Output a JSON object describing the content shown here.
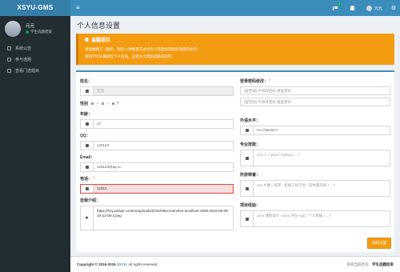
{
  "header": {
    "logo": "XSYU-GMS",
    "menu_icon": "≡",
    "notifications_badge": "4",
    "user_name": "元元",
    "settings_icon": "⚙"
  },
  "sidebar": {
    "user_name": "元元",
    "user_status": "学生选题结束",
    "items": [
      {
        "label": "系统公告",
        "icon": "bulletin-icon"
      },
      {
        "label": "参与选题",
        "icon": "pencil-icon"
      },
      {
        "label": "查看门选题目",
        "icon": "list-icon"
      }
    ]
  },
  "page": {
    "title": "个人信息设置"
  },
  "callout": {
    "title": "温馨提示",
    "line1": "请准确填写（编号，别的 3 种联系方式中至少有能找到您的简要的文字）",
    "line2": "请同学们认真填写个人信息，这将大大增加选题成功率。"
  },
  "form": {
    "name_label": "姓名：",
    "name_value": "元元",
    "gender_label": "性别",
    "age_label": "年龄：",
    "age_value": "17",
    "qq_label": "QQ：",
    "qq_value": "123123",
    "email_label": "Email：",
    "email_value": "123123@qq.cc",
    "phone_label": "电话：",
    "phone_required": "*",
    "phone_value": "12312",
    "intro_label": "自我介绍：",
    "intro_value": "https://hzy.pw/wp-content/uploads/2016/09/screenshot-localhost-3000-2016-09-09-19-21-06-2.png",
    "pwd_label": "登录密码修改：",
    "pwd_required": "*",
    "pwd_placeholder1": "[留空则] 不修改密码 重复密码",
    "pwd_placeholder2": "[留空则] 不修改密码 重复密码",
    "lang_label": "外语水平：",
    "lang_value": "I'm chinese~!",
    "skill_label": "专业技能：",
    "skill_placeholder": "C/C++ / Java / Python / ...?",
    "honor_label": "所获荣誉：",
    "honor_placeholder": "xxx 大赛一等奖 / 校级三好学生 / 软件著作权 / ...?",
    "project_label": "项目经验：",
    "project_placeholder": "xxxx 课程设计 / xxxx 外包 App / 个人网站 / ...?",
    "save_label": "保存设置"
  },
  "footer": {
    "copyright": "Copyright © 2016-2016",
    "brand": "XSYU.",
    "rights": "All rights reserved.",
    "status_label": "系统当前状态：",
    "status_value": "学生选题结束"
  },
  "colors": {
    "primary": "#3c8dbc",
    "warning": "#f39c12",
    "sidebar": "#222d32",
    "error": "#dd4b39"
  }
}
